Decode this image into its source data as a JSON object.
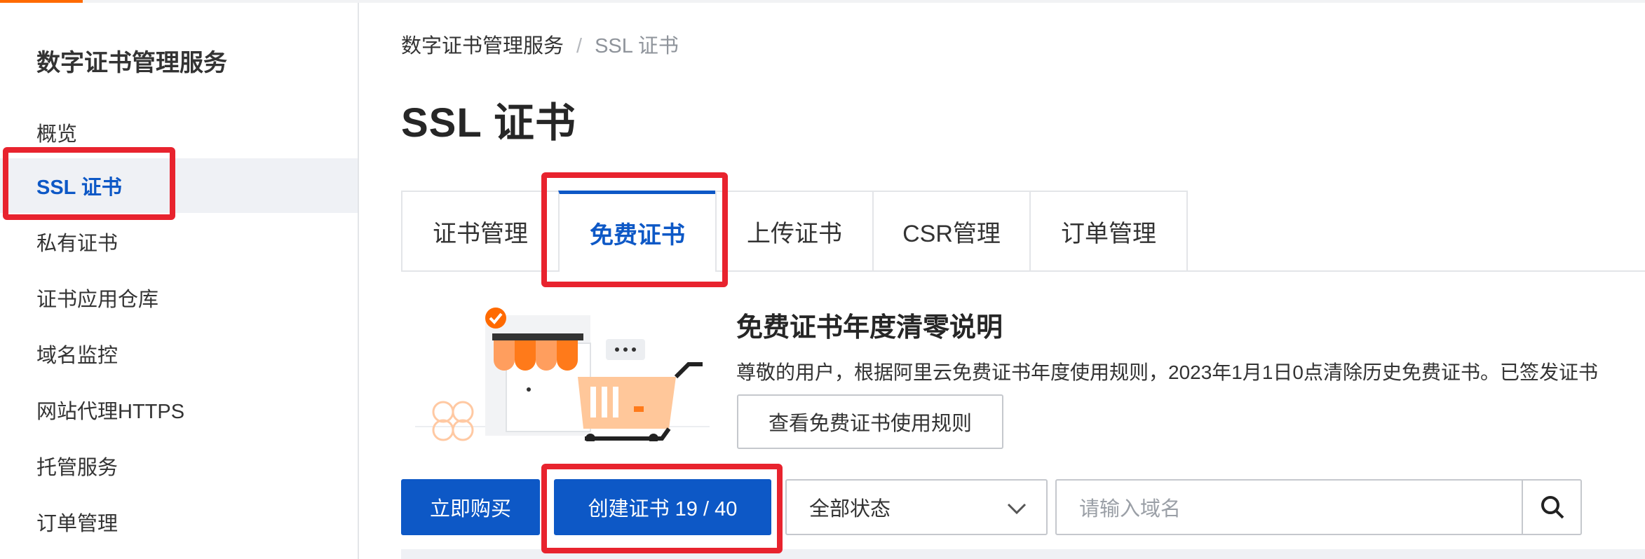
{
  "sidebar": {
    "title": "数字证书管理服务",
    "items": [
      {
        "label": "概览"
      },
      {
        "label": "SSL 证书",
        "active": true
      },
      {
        "label": "私有证书"
      },
      {
        "label": "证书应用仓库"
      },
      {
        "label": "域名监控"
      },
      {
        "label": "网站代理HTTPS"
      },
      {
        "label": "托管服务"
      },
      {
        "label": "订单管理"
      }
    ]
  },
  "breadcrumb": {
    "root": "数字证书管理服务",
    "separator": "/",
    "current": "SSL 证书"
  },
  "page": {
    "title": "SSL 证书"
  },
  "tabs": [
    {
      "label": "证书管理"
    },
    {
      "label": "免费证书",
      "active": true
    },
    {
      "label": "上传证书"
    },
    {
      "label": "CSR管理"
    },
    {
      "label": "订单管理"
    }
  ],
  "notice": {
    "title": "免费证书年度清零说明",
    "text": "尊敬的用户，根据阿里云免费证书年度使用规则，2023年1月1日0点清除历史免费证书。已签发证书",
    "button_label": "查看免费证书使用规则"
  },
  "toolbar": {
    "buy_label": "立即购买",
    "create_label": "创建证书 19 / 40",
    "status_select_value": "全部状态",
    "search_placeholder": "请输入域名"
  },
  "colors": {
    "primary": "#0d58c6",
    "highlight": "#e8232e",
    "brand_accent": "#ff6a00",
    "illustration_orange": "#ff7a1a"
  },
  "icons": [
    "chevron-down-icon",
    "search-icon",
    "check-badge-icon",
    "shopping-cart-icon",
    "shop-awning-icon"
  ]
}
